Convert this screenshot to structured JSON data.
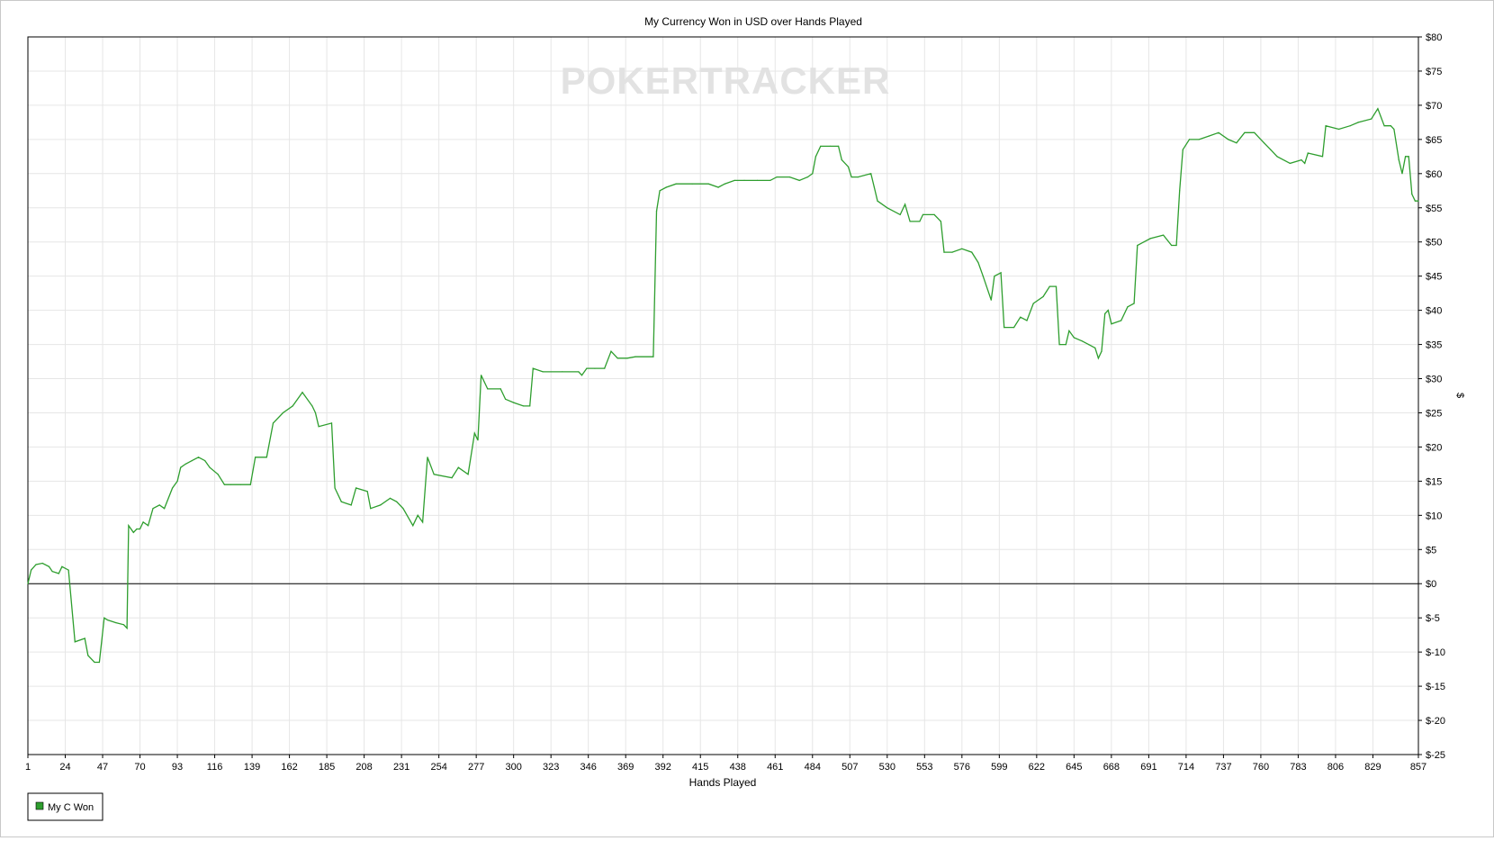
{
  "chart_data": {
    "type": "line",
    "title": "My Currency Won in USD over Hands Played",
    "xlabel": "Hands Played",
    "ylabel": "$",
    "watermark": "POKERTRACKER",
    "xlim": [
      1,
      857
    ],
    "ylim": [
      -25,
      80
    ],
    "x_ticks": [
      "1",
      "24",
      "47",
      "70",
      "93",
      "116",
      "139",
      "162",
      "185",
      "208",
      "231",
      "254",
      "277",
      "300",
      "323",
      "346",
      "369",
      "392",
      "415",
      "438",
      "461",
      "484",
      "507",
      "530",
      "553",
      "576",
      "599",
      "622",
      "645",
      "668",
      "691",
      "714",
      "737",
      "760",
      "783",
      "806",
      "829",
      "857"
    ],
    "y_ticks": [
      "$80",
      "$75",
      "$70",
      "$65",
      "$60",
      "$55",
      "$50",
      "$45",
      "$40",
      "$35",
      "$30",
      "$25",
      "$20",
      "$15",
      "$10",
      "$5",
      "$0",
      "$-5",
      "$-10",
      "$-15",
      "$-20",
      "$-25"
    ],
    "y_tick_values": [
      80,
      75,
      70,
      65,
      60,
      55,
      50,
      45,
      40,
      35,
      30,
      25,
      20,
      15,
      10,
      5,
      0,
      -5,
      -10,
      -15,
      -20,
      -25
    ],
    "grid": true,
    "legend_position": "bottom-left",
    "colors": {
      "series": "#2e9e2e",
      "grid": "#e6e6e6",
      "zero_line": "#000000",
      "watermark": "#e2e2e2"
    },
    "series": [
      {
        "name": "My C Won",
        "points": [
          [
            1,
            0
          ],
          [
            3,
            2
          ],
          [
            6,
            2.8
          ],
          [
            10,
            3
          ],
          [
            14,
            2.5
          ],
          [
            16,
            1.8
          ],
          [
            20,
            1.5
          ],
          [
            22,
            2.5
          ],
          [
            26,
            2
          ],
          [
            30,
            -8.5
          ],
          [
            36,
            -8
          ],
          [
            38,
            -10.5
          ],
          [
            42,
            -11.5
          ],
          [
            45,
            -11.5
          ],
          [
            48,
            -5
          ],
          [
            50,
            -5.3
          ],
          [
            55,
            -5.7
          ],
          [
            60,
            -6
          ],
          [
            62,
            -6.5
          ],
          [
            63,
            8.5
          ],
          [
            66,
            7.5
          ],
          [
            68,
            8
          ],
          [
            70,
            8
          ],
          [
            72,
            9
          ],
          [
            75,
            8.5
          ],
          [
            78,
            11
          ],
          [
            82,
            11.5
          ],
          [
            85,
            11
          ],
          [
            90,
            14
          ],
          [
            93,
            15
          ],
          [
            95,
            17
          ],
          [
            98,
            17.5
          ],
          [
            102,
            18
          ],
          [
            106,
            18.5
          ],
          [
            110,
            18
          ],
          [
            113,
            17
          ],
          [
            118,
            16
          ],
          [
            122,
            14.5
          ],
          [
            126,
            14.5
          ],
          [
            132,
            14.5
          ],
          [
            138,
            14.5
          ],
          [
            141,
            18.5
          ],
          [
            148,
            18.5
          ],
          [
            152,
            23.5
          ],
          [
            158,
            25
          ],
          [
            164,
            26
          ],
          [
            170,
            28
          ],
          [
            176,
            26
          ],
          [
            178,
            25
          ],
          [
            180,
            23
          ],
          [
            188,
            23.5
          ],
          [
            190,
            14
          ],
          [
            194,
            12
          ],
          [
            200,
            11.5
          ],
          [
            203,
            14
          ],
          [
            210,
            13.5
          ],
          [
            212,
            11
          ],
          [
            218,
            11.5
          ],
          [
            224,
            12.5
          ],
          [
            228,
            12
          ],
          [
            232,
            11
          ],
          [
            238,
            8.5
          ],
          [
            241,
            10
          ],
          [
            244,
            9
          ],
          [
            247,
            18.5
          ],
          [
            251,
            16
          ],
          [
            262,
            15.5
          ],
          [
            266,
            17
          ],
          [
            272,
            16
          ],
          [
            276,
            22
          ],
          [
            278,
            21
          ],
          [
            280,
            30.5
          ],
          [
            284,
            28.5
          ],
          [
            292,
            28.5
          ],
          [
            295,
            27
          ],
          [
            300,
            26.5
          ],
          [
            306,
            26
          ],
          [
            310,
            26
          ],
          [
            312,
            31.5
          ],
          [
            318,
            31
          ],
          [
            330,
            31
          ],
          [
            340,
            31
          ],
          [
            342,
            30.5
          ],
          [
            345,
            31.5
          ],
          [
            350,
            31.5
          ],
          [
            356,
            31.5
          ],
          [
            360,
            34
          ],
          [
            364,
            33
          ],
          [
            370,
            33
          ],
          [
            375,
            33.2
          ],
          [
            386,
            33.2
          ],
          [
            388,
            54.5
          ],
          [
            390,
            57.5
          ],
          [
            394,
            58
          ],
          [
            400,
            58.5
          ],
          [
            410,
            58.5
          ],
          [
            420,
            58.5
          ],
          [
            426,
            58
          ],
          [
            430,
            58.5
          ],
          [
            436,
            59
          ],
          [
            442,
            59
          ],
          [
            450,
            59
          ],
          [
            458,
            59
          ],
          [
            462,
            59.5
          ],
          [
            470,
            59.5
          ],
          [
            476,
            59
          ],
          [
            481,
            59.5
          ],
          [
            484,
            60
          ],
          [
            486,
            62.5
          ],
          [
            489,
            64
          ],
          [
            495,
            64
          ],
          [
            500,
            64
          ],
          [
            502,
            62
          ],
          [
            506,
            61
          ],
          [
            508,
            59.5
          ],
          [
            512,
            59.5
          ],
          [
            520,
            60
          ],
          [
            522,
            58
          ],
          [
            524,
            56
          ],
          [
            530,
            55
          ],
          [
            538,
            54
          ],
          [
            541,
            55.5
          ],
          [
            544,
            53
          ],
          [
            550,
            53
          ],
          [
            552,
            54
          ],
          [
            559,
            54
          ],
          [
            563,
            53
          ],
          [
            565,
            48.5
          ],
          [
            570,
            48.5
          ],
          [
            576,
            49
          ],
          [
            582,
            48.5
          ],
          [
            586,
            47
          ],
          [
            589,
            45
          ],
          [
            594,
            41.5
          ],
          [
            596,
            45
          ],
          [
            600,
            45.5
          ],
          [
            602,
            37.5
          ],
          [
            608,
            37.5
          ],
          [
            612,
            39
          ],
          [
            616,
            38.5
          ],
          [
            620,
            41
          ],
          [
            626,
            42
          ],
          [
            630,
            43.5
          ],
          [
            634,
            43.5
          ],
          [
            636,
            35
          ],
          [
            640,
            35
          ],
          [
            642,
            37
          ],
          [
            645,
            36
          ],
          [
            650,
            35.5
          ],
          [
            654,
            35
          ],
          [
            658,
            34.5
          ],
          [
            660,
            33
          ],
          [
            662,
            34
          ],
          [
            664,
            39.5
          ],
          [
            666,
            40
          ],
          [
            668,
            38
          ],
          [
            674,
            38.5
          ],
          [
            678,
            40.5
          ],
          [
            682,
            41
          ],
          [
            684,
            49.5
          ],
          [
            688,
            50
          ],
          [
            692,
            50.5
          ],
          [
            700,
            51
          ],
          [
            705,
            49.5
          ],
          [
            708,
            49.5
          ],
          [
            710,
            57.5
          ],
          [
            712,
            63.5
          ],
          [
            716,
            65
          ],
          [
            722,
            65
          ],
          [
            728,
            65.5
          ],
          [
            734,
            66
          ],
          [
            740,
            65
          ],
          [
            745,
            64.5
          ],
          [
            750,
            66
          ],
          [
            756,
            66
          ],
          [
            762,
            64.5
          ],
          [
            766,
            63.5
          ],
          [
            770,
            62.5
          ],
          [
            778,
            61.5
          ],
          [
            785,
            62
          ],
          [
            787,
            61.5
          ],
          [
            789,
            63
          ],
          [
            798,
            62.5
          ],
          [
            800,
            67
          ],
          [
            808,
            66.5
          ],
          [
            815,
            67
          ],
          [
            820,
            67.5
          ],
          [
            828,
            68
          ],
          [
            832,
            69.5
          ],
          [
            836,
            67
          ],
          [
            840,
            67
          ],
          [
            842,
            66.5
          ],
          [
            845,
            62
          ],
          [
            847,
            60
          ],
          [
            849,
            62.5
          ],
          [
            851,
            62.5
          ],
          [
            853,
            57
          ],
          [
            855,
            56
          ],
          [
            857,
            56
          ]
        ]
      }
    ]
  }
}
